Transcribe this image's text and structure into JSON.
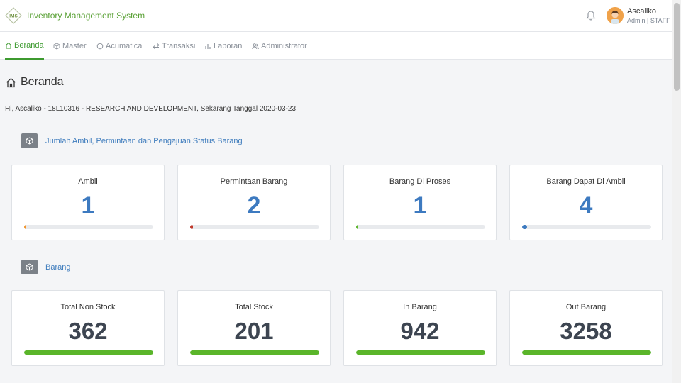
{
  "app": {
    "logo_text": "IMS",
    "title": "Inventory Management System"
  },
  "user": {
    "name": "Ascaliko",
    "role": "Admin | STAFF"
  },
  "nav": [
    {
      "label": "Beranda",
      "icon": "home-icon",
      "active": true
    },
    {
      "label": "Master",
      "icon": "cube-icon"
    },
    {
      "label": "Acumatica",
      "icon": "circle-icon"
    },
    {
      "label": "Transaksi",
      "icon": "swap-icon"
    },
    {
      "label": "Laporan",
      "icon": "chart-bar-icon"
    },
    {
      "label": "Administrator",
      "icon": "users-icon"
    }
  ],
  "page": {
    "title": "Beranda",
    "greeting": "Hi, Ascaliko - 18L10316 - RESEARCH AND DEVELOPMENT, Sekarang Tanggal 2020-03-23"
  },
  "sections": [
    {
      "label": "Jumlah Ambil, Permintaan dan Pengajuan Status Barang",
      "cards": [
        {
          "title": "Ambil",
          "value": "1",
          "progress": 0.01,
          "bar_color": "#f0952e"
        },
        {
          "title": "Permintaan Barang",
          "value": "2",
          "progress": 0.02,
          "bar_color": "#c0392b"
        },
        {
          "title": "Barang Di Proses",
          "value": "1",
          "progress": 0.01,
          "bar_color": "#5ab52a"
        },
        {
          "title": "Barang Dapat Di Ambil",
          "value": "4",
          "progress": 0.04,
          "bar_color": "#3d7ac0"
        }
      ]
    },
    {
      "label": "Barang",
      "cards": [
        {
          "title": "Total Non Stock",
          "value": "362",
          "progress": 1.0,
          "bar_color": "#5ab52a"
        },
        {
          "title": "Total Stock",
          "value": "201",
          "progress": 1.0,
          "bar_color": "#5ab52a"
        },
        {
          "title": "In Barang",
          "value": "942",
          "progress": 1.0,
          "bar_color": "#5ab52a"
        },
        {
          "title": "Out Barang",
          "value": "3258",
          "progress": 1.0,
          "bar_color": "#5ab52a"
        }
      ]
    }
  ],
  "colors": {
    "accent": "#5aa136",
    "link": "#3e7cbd",
    "number_blue": "#3d7ac0"
  }
}
